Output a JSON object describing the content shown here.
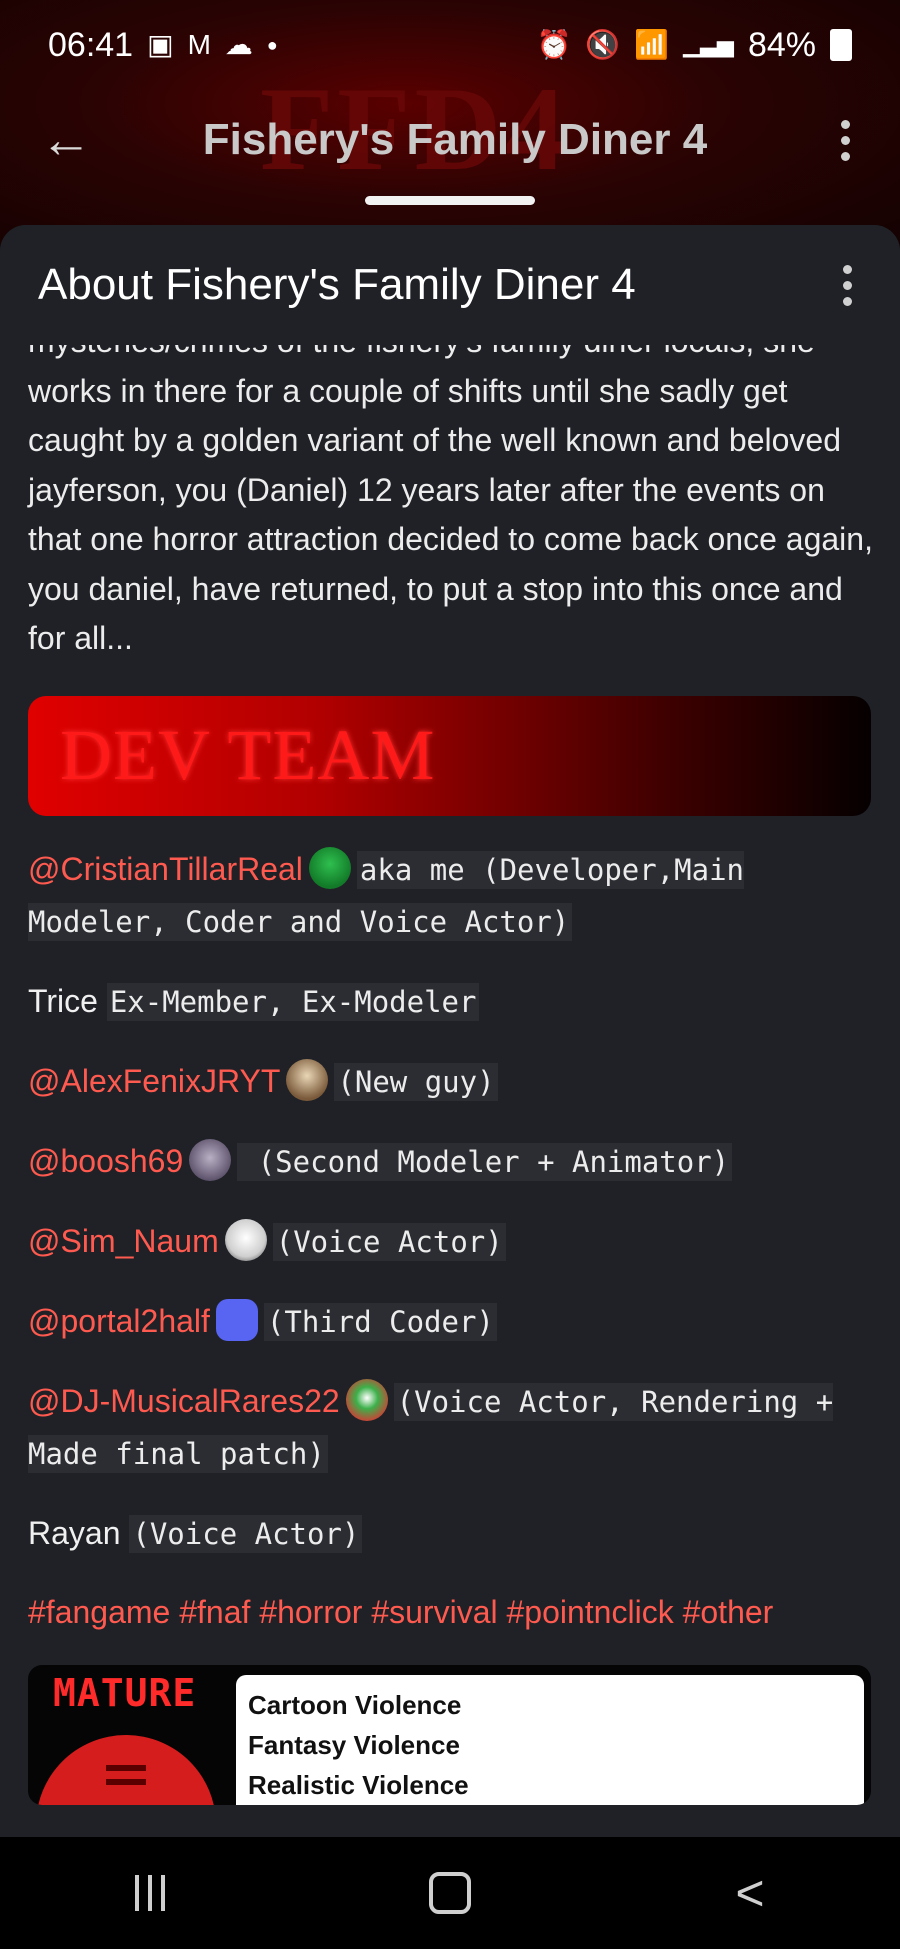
{
  "status_bar": {
    "time": "06:41",
    "battery": "84%",
    "left_icons": [
      "gallery-icon",
      "gmail-icon",
      "cloud-icon",
      "dot-icon"
    ],
    "right_icons": [
      "alarm-icon",
      "mute-icon",
      "wifi-icon",
      "signal-icon",
      "battery-icon"
    ]
  },
  "app_bar": {
    "title": "Fishery's Family Diner 4"
  },
  "sheet": {
    "title": "About Fishery's Family Diner 4",
    "description": "mysteries/crimes of the fishery's family diner locals, she works in there for a couple of shifts until she sadly get caught by a golden variant of the well known and beloved jayferson, you (Daniel) 12 years later after the events on that one horror attraction decided to come back once again, you daniel, have returned, to put a stop into this once and for all...",
    "dev_team_banner": "DEV TEAM",
    "credits": [
      {
        "name": "@CristianTillarReal",
        "role": "aka me (Developer,Main Modeler, Coder and Voice Actor)"
      },
      {
        "name": "Trice",
        "role": "Ex-Member, Ex-Modeler"
      },
      {
        "name": "@AlexFenixJRYT",
        "role": "(New guy)"
      },
      {
        "name": "@boosh69",
        "role": " (Second Modeler + Animator)"
      },
      {
        "name": "@Sim_Naum",
        "role": "(Voice Actor)"
      },
      {
        "name": "@portal2half",
        "role": "(Third Coder)"
      },
      {
        "name": "@DJ-MusicalRares22",
        "role": "(Voice Actor, Rendering + Made final patch)"
      },
      {
        "name": "Rayan",
        "role": "(Voice Actor)"
      }
    ],
    "tags": "#fangame #fnaf #horror #survival #pointnclick #other",
    "rating": {
      "label": "MATURE",
      "descriptors": [
        "Cartoon Violence",
        "Fantasy Violence",
        "Realistic Violence"
      ]
    }
  },
  "colors": {
    "mention": "#ff5a4f",
    "background": "#1f2126",
    "banner_red": "#e00000"
  }
}
